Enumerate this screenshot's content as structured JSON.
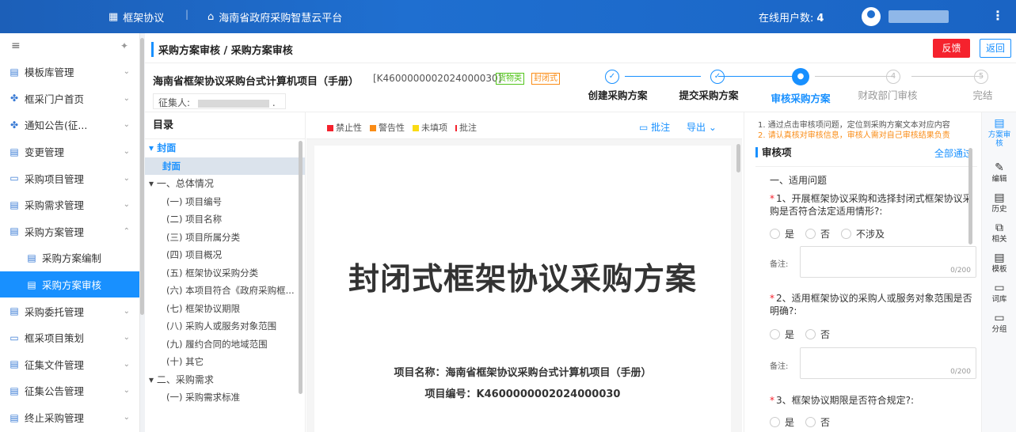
{
  "topbar": {
    "menu_label": "框架协议",
    "separator": "|",
    "platform_label": "海南省政府采购智慧云平台",
    "online_label": "在线用户数:",
    "online_count": "4",
    "more": "⋮"
  },
  "sidebar": {
    "items": [
      {
        "icon": "▤",
        "label": "模板库管理",
        "chev": "⌄"
      },
      {
        "icon": "✤",
        "label": "框采门户首页",
        "chev": "⌄"
      },
      {
        "icon": "✤",
        "label": "通知公告(征...",
        "chev": "⌄"
      },
      {
        "icon": "▤",
        "label": "变更管理",
        "chev": "⌄"
      },
      {
        "icon": "▭",
        "label": "采购项目管理",
        "chev": "⌄"
      },
      {
        "icon": "▤",
        "label": "采购需求管理",
        "chev": "⌄"
      },
      {
        "icon": "▤",
        "label": "采购方案管理",
        "chev": "⌃"
      },
      {
        "icon": "▤",
        "label": "采购方案编制",
        "chev": ""
      },
      {
        "icon": "▤",
        "label": "采购方案审核",
        "chev": ""
      },
      {
        "icon": "▤",
        "label": "采购委托管理",
        "chev": "⌄"
      },
      {
        "icon": "▭",
        "label": "框采项目策划",
        "chev": "⌄"
      },
      {
        "icon": "▤",
        "label": "征集文件管理",
        "chev": "⌄"
      },
      {
        "icon": "▤",
        "label": "征集公告管理",
        "chev": "⌄"
      },
      {
        "icon": "▤",
        "label": "终止采购管理",
        "chev": "⌄"
      }
    ]
  },
  "breadcrumb": "采购方案审核 / 采购方案审核",
  "buttons": {
    "feedback": "反馈",
    "back": "返回"
  },
  "project": {
    "name": "海南省框架协议采购台式计算机项目（手册）",
    "code": "[K4600000002024000030]",
    "tag1": "货物类",
    "tag2": "封闭式",
    "collector_label": "征集人:",
    "collector_suffix": "."
  },
  "steps": [
    {
      "icon": "✓",
      "label": "创建采购方案"
    },
    {
      "icon": "✓",
      "label": "提交采购方案"
    },
    {
      "icon": "●",
      "label": "审核采购方案"
    },
    {
      "icon": "4",
      "label": "财政部门审核"
    },
    {
      "icon": "5",
      "label": "完结"
    }
  ],
  "toc": {
    "title": "目录",
    "rows": [
      "▾ 封面",
      "封面",
      "▾ 一、总体情况",
      "(一) 项目编号",
      "(二) 项目名称",
      "(三) 项目所属分类",
      "(四) 项目概况",
      "(五) 框架协议采购分类",
      "(六) 本项目符合《政府采购框...",
      "(七) 框架协议期限",
      "(八) 采购人或服务对象范围",
      "(九) 履约合同的地域范围",
      "(十) 其它",
      "▾ 二、采购需求",
      "(一) 采购需求标准"
    ]
  },
  "doc": {
    "legend": [
      "禁止性",
      "警告性",
      "未填项",
      "批注"
    ],
    "legend_colors": [
      "#f5222d",
      "#fa8c16",
      "#fadb14",
      "#f5222d"
    ],
    "annotate": "批注",
    "export": "导出 ⌄",
    "heading": "封闭式框架协议采购方案",
    "project_name": "项目名称：海南省框架协议采购台式计算机项目（手册）",
    "project_no": "项目编号：K4600000002024000030"
  },
  "review": {
    "tip1": "1. 通过点击审核项问题，定位到采购方案文本对应内容",
    "tip2": "2. 请认真核对审核信息，审核人需对自己审核结果负责",
    "section": "审核项",
    "all_pass": "全部通过",
    "group": "一、适用问题",
    "q1": "1、开展框架协议采购和选择封闭式框架协议采购是否符合法定适用情形?:",
    "q2": "2、适用框架协议的采购人或服务对象范围是否明确?:",
    "q3": "3、框架协议期限是否符合规定?:",
    "opt_yes": "是",
    "opt_no": "否",
    "opt_na": "不涉及",
    "note_label": "备注:",
    "note_count": "0/200",
    "required": "*"
  },
  "tools": [
    {
      "icon": "▤",
      "label": "方案审核"
    },
    {
      "icon": "✎",
      "label": "编辑"
    },
    {
      "icon": "▤",
      "label": "历史"
    },
    {
      "icon": "⧉",
      "label": "相关"
    },
    {
      "icon": "▤",
      "label": "模板"
    },
    {
      "icon": "▭",
      "label": "词库"
    },
    {
      "icon": "▭",
      "label": "分组"
    }
  ]
}
